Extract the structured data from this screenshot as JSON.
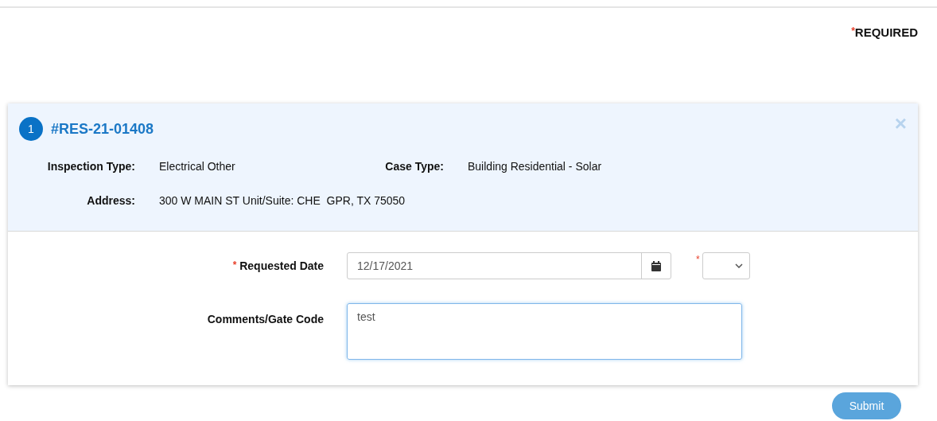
{
  "required_note": {
    "mark": "*",
    "label": "REQUIRED"
  },
  "card": {
    "number": "1",
    "case_id": "#RES-21-01408",
    "close": "×",
    "details": [
      {
        "label": "Inspection Type:",
        "value": "Electrical Other"
      },
      {
        "label": "Case Type:",
        "value": "Building Residential - Solar"
      },
      {
        "label": "Address:",
        "value": "300 W MAIN ST Unit/Suite: CHE  GPR, TX 75050"
      }
    ],
    "form": {
      "requested_date": {
        "mark": "*",
        "label": "Requested Date",
        "value": "12/17/2021",
        "time_mark": "*"
      },
      "comments": {
        "label": "Comments/Gate Code",
        "value": "test"
      }
    }
  },
  "submit": {
    "label": "Submit",
    "disabled": true
  }
}
